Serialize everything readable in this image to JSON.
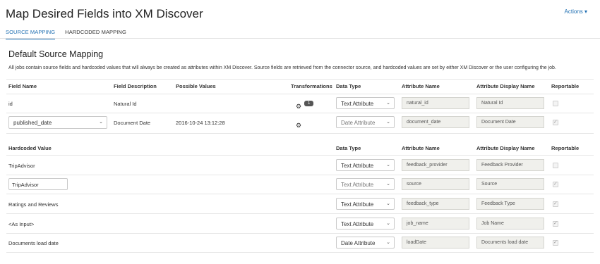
{
  "header": {
    "title": "Map Desired Fields into XM Discover",
    "actions": "Actions ▾"
  },
  "tabs": [
    {
      "label": "SOURCE MAPPING"
    },
    {
      "label": "HARDCODED MAPPING"
    }
  ],
  "panel": {
    "title": "Default Source Mapping",
    "description": "All jobs contain source fields and hardcoded values that will always be created as attributes within XM Discover. Source fields are retrieved from the connector source, and hardcoded values are set by either XM Discover or the user configuring the job."
  },
  "source_table": {
    "headers": {
      "field_name": "Field Name",
      "field_description": "Field Description",
      "possible_values": "Possible Values",
      "transformations": "Transformations",
      "data_type": "Data Type",
      "attribute_name": "Attribute Name",
      "attribute_display_name": "Attribute Display Name",
      "reportable": "Reportable"
    },
    "rows": [
      {
        "field_name": "id",
        "field_description": "Natural Id",
        "possible_values": "",
        "transformation_count": "1",
        "data_type": "Text Attribute",
        "attribute_name": "natural_id",
        "attribute_display_name": "Natural Id",
        "reportable": false
      },
      {
        "field_name": "published_date",
        "field_description": "Document Date",
        "possible_values": "2016-10-24 13:12:28",
        "transformation_count": "",
        "data_type": "Date Attribute",
        "attribute_name": "document_date",
        "attribute_display_name": "Document Date",
        "reportable": true
      }
    ]
  },
  "hardcoded_table": {
    "headers": {
      "hardcoded_value": "Hardcoded Value",
      "data_type": "Data Type",
      "attribute_name": "Attribute Name",
      "attribute_display_name": "Attribute Display Name",
      "reportable": "Reportable"
    },
    "rows": [
      {
        "value": "TripAdvisor",
        "data_type": "Text Attribute",
        "attribute_name": "feedback_provider",
        "attribute_display_name": "Feedback Provider",
        "reportable": false
      },
      {
        "value": "TripAdvisor",
        "data_type": "Text Attribute",
        "attribute_name": "source",
        "attribute_display_name": "Source",
        "reportable": true
      },
      {
        "value": "Ratings and Reviews",
        "data_type": "Text Attribute",
        "attribute_name": "feedback_type",
        "attribute_display_name": "Feedback Type",
        "reportable": true
      },
      {
        "value": "<As Input>",
        "data_type": "Text Attribute",
        "attribute_name": "job_name",
        "attribute_display_name": "Job Name",
        "reportable": true
      },
      {
        "value": "Documents load date",
        "data_type": "Date Attribute",
        "attribute_name": "loadDate",
        "attribute_display_name": "Documents load date",
        "reportable": true
      }
    ]
  },
  "colors": {
    "accent": "#1f6fb2",
    "readonly_bg": "#f0f0ec"
  }
}
